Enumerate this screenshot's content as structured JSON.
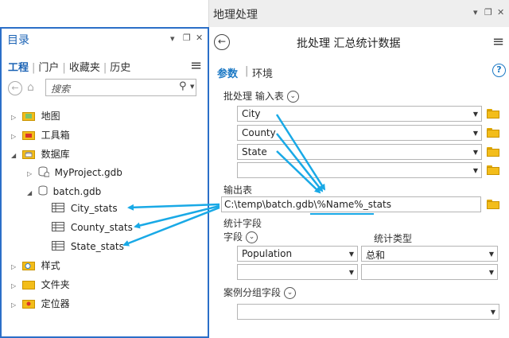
{
  "geoprocessing": {
    "title": "地理处理",
    "win_controls": {
      "pin": "▾",
      "restore": "❐",
      "close": "✕"
    },
    "back_icon": "back-arrow-icon",
    "tool_title": "批处理 汇总统计数据",
    "menu_icon": "≡",
    "tabs": {
      "params": "参数",
      "env": "环境",
      "sep": "|"
    },
    "help": "?",
    "batch_input_label": "批处理 输入表",
    "inputs": [
      "City",
      "County",
      "State",
      ""
    ],
    "output_label": "输出表",
    "output_value": "C:\\temp\\batch.gdb\\%Name%_stats",
    "stats_fields_label": "统计字段",
    "field_col": "字段",
    "stat_type_col": "统计类型",
    "stats_rows": [
      {
        "field": "Population",
        "type": "总和"
      },
      {
        "field": "",
        "type": ""
      }
    ],
    "case_field_label": "案例分组字段",
    "case_value": ""
  },
  "catalog": {
    "title": "目录",
    "win_controls": {
      "pin": "▾",
      "restore": "❐",
      "close": "✕"
    },
    "tabs": [
      "工程",
      "门户",
      "收藏夹",
      "历史"
    ],
    "menu_icon": "≡",
    "search_placeholder": "搜索",
    "tree": {
      "maps": "地图",
      "toolboxes": "工具箱",
      "databases": "数据库",
      "project_gdb": "MyProject.gdb",
      "batch_gdb": "batch.gdb",
      "tables": [
        "City_stats",
        "County_stats",
        "State_stats"
      ],
      "styles": "样式",
      "folders": "文件夹",
      "locators": "定位器"
    }
  },
  "colors": {
    "accent": "#1b78c4",
    "arrow": "#19a9e6",
    "folder": "#f3bd1a",
    "pane_border": "#2b6fc8"
  }
}
